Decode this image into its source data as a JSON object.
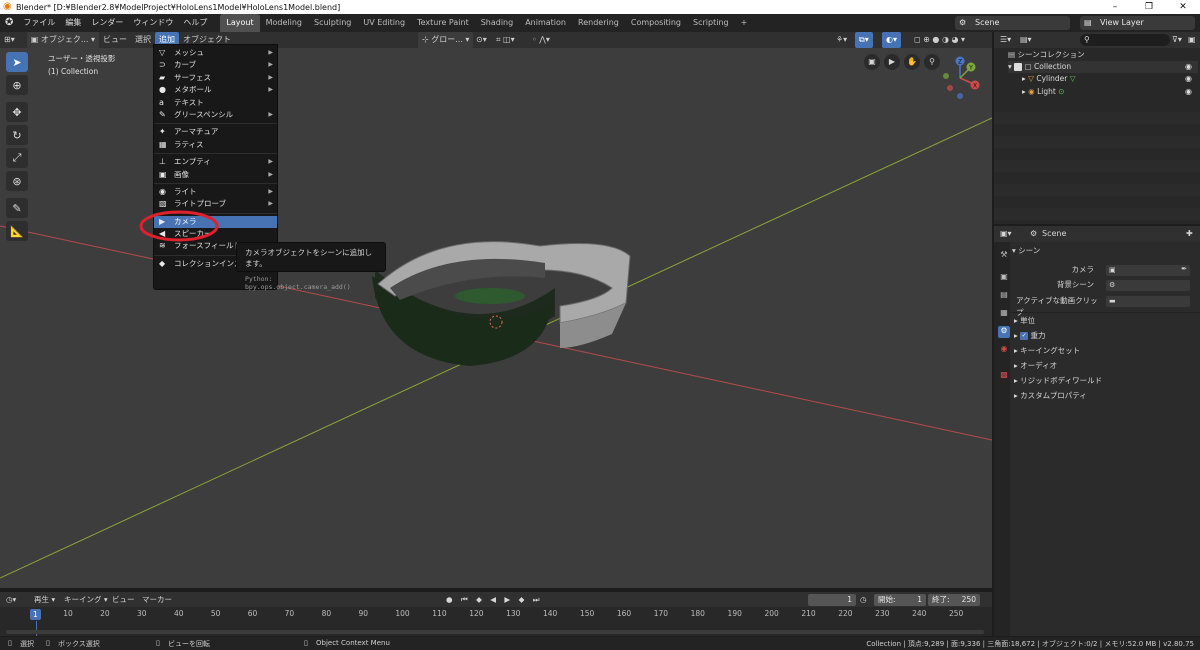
{
  "title": "Blender* [D:¥Blender2.8¥ModelProject¥HoloLens1Model¥HoloLens1Model.blend]",
  "window_buttons": [
    "–",
    "❐",
    "✕"
  ],
  "menus": [
    "ファイル",
    "編集",
    "レンダー",
    "ウィンドウ",
    "ヘルプ"
  ],
  "workspaces": [
    "Layout",
    "Modeling",
    "Sculpting",
    "UV Editing",
    "Texture Paint",
    "Shading",
    "Animation",
    "Rendering",
    "Compositing",
    "Scripting",
    "+"
  ],
  "scene_name": "Scene",
  "view_layer": "View Layer",
  "viewport_header": {
    "mode": "オブジェク...",
    "items": [
      "ビュー",
      "選択",
      "追加",
      "オブジェクト"
    ],
    "transform": "グロー..."
  },
  "viewport_info": {
    "line1": "ユーザー・透視投影",
    "line2": "(1) Collection"
  },
  "gizmo_axes": {
    "x": "X",
    "y": "Y",
    "z": "Z"
  },
  "add_menu": {
    "group1": [
      {
        "icon": "mesh-icon",
        "glyph": "▽",
        "label": "メッシュ",
        "sub": true
      },
      {
        "icon": "curve-icon",
        "glyph": "⊃",
        "label": "カーブ",
        "sub": true
      },
      {
        "icon": "surface-icon",
        "glyph": "▰",
        "label": "サーフェス",
        "sub": true
      },
      {
        "icon": "metaball-icon",
        "glyph": "●",
        "label": "メタボール",
        "sub": true
      },
      {
        "icon": "text-icon",
        "glyph": "a",
        "label": "テキスト",
        "sub": false
      },
      {
        "icon": "grease-pencil-icon",
        "glyph": "✎",
        "label": "グリースペンシル",
        "sub": true
      }
    ],
    "group2": [
      {
        "icon": "armature-icon",
        "glyph": "✦",
        "label": "アーマチュア",
        "sub": false
      },
      {
        "icon": "lattice-icon",
        "glyph": "▦",
        "label": "ラティス",
        "sub": false
      }
    ],
    "group3": [
      {
        "icon": "empty-icon",
        "glyph": "⊥",
        "label": "エンプティ",
        "sub": true
      },
      {
        "icon": "image-icon",
        "glyph": "▣",
        "label": "画像",
        "sub": true
      }
    ],
    "group4": [
      {
        "icon": "light-icon",
        "glyph": "◉",
        "label": "ライト",
        "sub": true
      },
      {
        "icon": "light-probe-icon",
        "glyph": "▧",
        "label": "ライトプローブ",
        "sub": true
      }
    ],
    "group5": [
      {
        "icon": "camera-icon",
        "glyph": "▶",
        "label": "カメラ",
        "sub": false,
        "highlight": true
      },
      {
        "icon": "speaker-icon",
        "glyph": "◀",
        "label": "スピーカー",
        "sub": false
      },
      {
        "icon": "force-field-icon",
        "glyph": "≋",
        "label": "フォースフィールド",
        "sub": true
      }
    ],
    "group6": [
      {
        "icon": "collection-instance-icon",
        "glyph": "◆",
        "label": "コレクションインスタンス",
        "sub": true
      }
    ]
  },
  "tooltip": {
    "text": "カメラオブジェクトをシーンに追加します。",
    "python": "Python: bpy.ops.object.camera_add()"
  },
  "outliner": {
    "root": "シーンコレクション",
    "collection": "Collection",
    "objects": [
      {
        "name": "Cylinder",
        "icon": "mesh-icon"
      },
      {
        "name": "Light",
        "icon": "light-icon"
      }
    ]
  },
  "properties": {
    "context": "Scene",
    "panel": "シーン",
    "fields": [
      {
        "label": "カメラ",
        "value": ""
      },
      {
        "label": "背景シーン",
        "value": ""
      },
      {
        "label": "アクティブな動画クリップ",
        "value": ""
      }
    ],
    "sections": [
      "単位",
      "重力",
      "キーイングセット",
      "オーディオ",
      "リジッドボディワールド",
      "カスタムプロパティ"
    ],
    "gravity_checked": true
  },
  "timeline": {
    "items": [
      "再生",
      "キーイング",
      "ビュー",
      "マーカー"
    ],
    "current_frame": "1",
    "start_label": "開始:",
    "start": "1",
    "end_label": "終了:",
    "end": "250",
    "ruler": [
      "1",
      "10",
      "20",
      "30",
      "40",
      "50",
      "60",
      "70",
      "80",
      "90",
      "100",
      "110",
      "120",
      "130",
      "140",
      "150",
      "160",
      "170",
      "180",
      "190",
      "200",
      "210",
      "220",
      "230",
      "240",
      "250"
    ]
  },
  "status": {
    "left1": "選択",
    "left2": "ボックス選択",
    "left3": "ビューを回転",
    "left4": "Object Context Menu",
    "right": "Collection | 頂点:9,289 | 面:9,336 | 三角面:18,672 | オブジェクト:0/2 | メモリ:52.0 MB | v2.80.75"
  },
  "colors": {
    "accent": "#4772b3",
    "highlight_ring": "#e0202a",
    "x_axis": "#b84a4a",
    "y_axis": "#8aa53a"
  }
}
